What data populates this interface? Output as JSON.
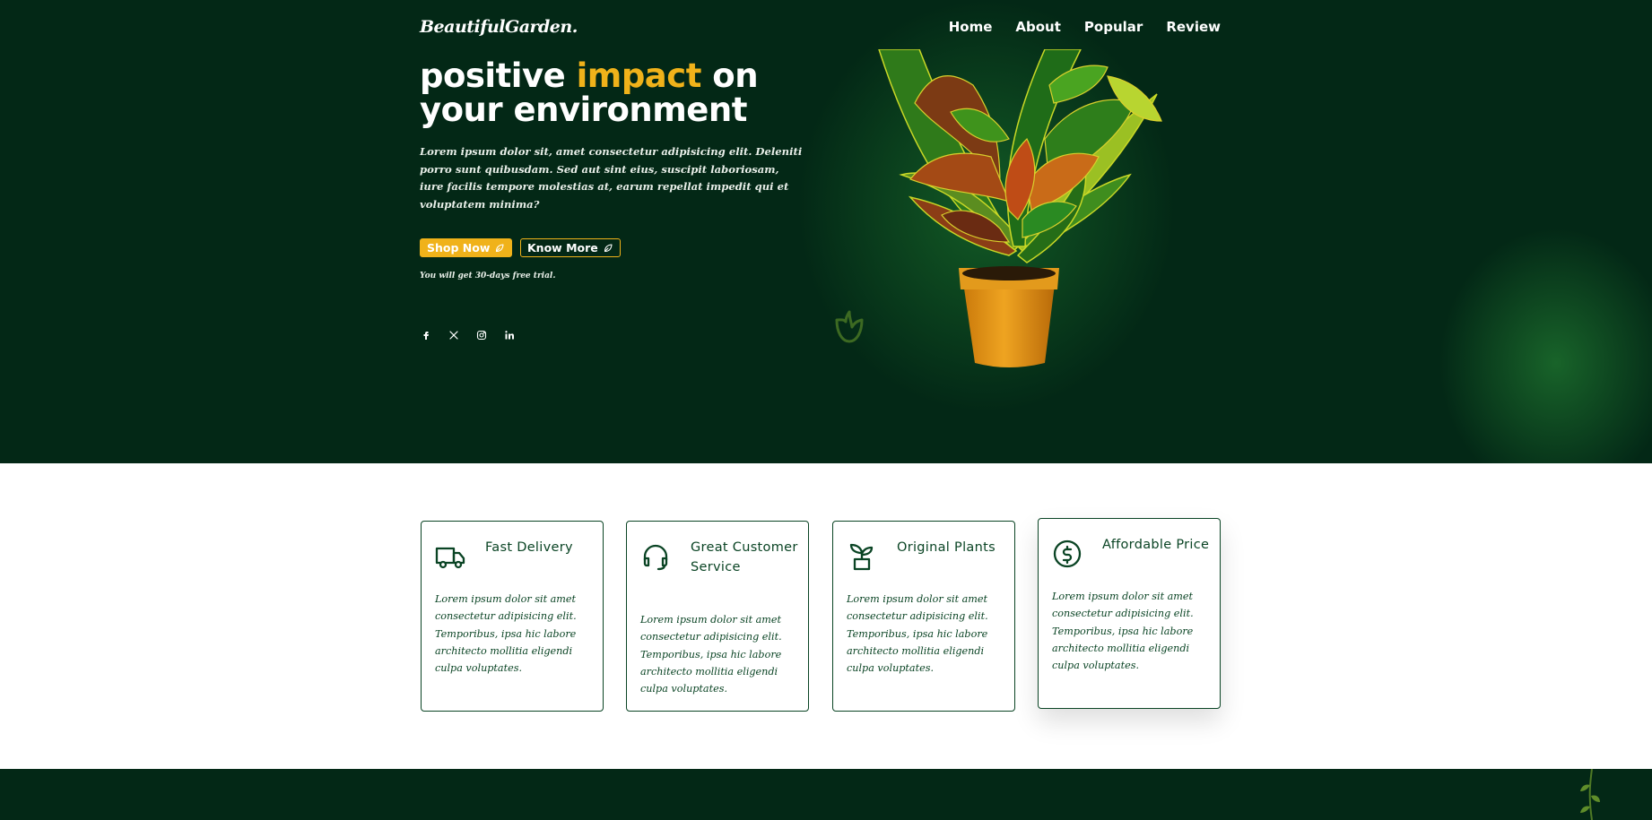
{
  "header": {
    "logo": "BeautifulGarden.",
    "nav": [
      "Home",
      "About",
      "Popular",
      "Review"
    ]
  },
  "hero": {
    "headline_pre": "positive ",
    "headline_highlight": "impact",
    "headline_post": " on",
    "headline_line2": "your environment",
    "description": "Lorem ipsum dolor sit, amet consectetur adipisicing elit. Deleniti porro sunt quibusdam. Sed aut sint eius, suscipit laboriosam, iure facilis tempore molestias at, earum repellat impedit qui et voluptatem minima?",
    "shop_button": "Shop Now",
    "know_button": "Know More",
    "trial_note": "You will get 30-days free trial.",
    "socials": [
      "facebook-icon",
      "x-icon",
      "instagram-icon",
      "linkedin-icon"
    ]
  },
  "features": [
    {
      "title": "Fast Delivery",
      "icon": "truck-icon",
      "text": "Lorem ipsum dolor sit amet consectetur adipisicing elit. Temporibus, ipsa hic labore architecto mollitia eligendi culpa voluptates."
    },
    {
      "title": "Great Customer Service",
      "icon": "headset-icon",
      "text": "Lorem ipsum dolor sit amet consectetur adipisicing elit. Temporibus, ipsa hic labore architecto mollitia eligendi culpa voluptates."
    },
    {
      "title": "Original Plants",
      "icon": "plant-pot-icon",
      "text": "Lorem ipsum dolor sit amet consectetur adipisicing elit. Temporibus, ipsa hic labore architecto mollitia eligendi culpa voluptates."
    },
    {
      "title": "Affordable Price",
      "icon": "dollar-circle-icon",
      "text": "Lorem ipsum dolor sit amet consectetur adipisicing elit. Temporibus, ipsa hic labore architecto mollitia eligendi culpa voluptates."
    }
  ],
  "colors": {
    "background_dark": "#032816",
    "accent": "#f0b21a",
    "card_border": "#0a4424"
  }
}
